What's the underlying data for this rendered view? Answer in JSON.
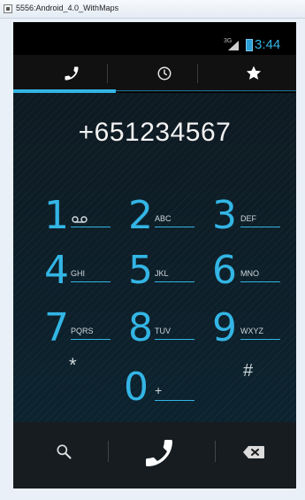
{
  "window": {
    "title": "5556:Android_4.0_WithMaps"
  },
  "status": {
    "network": "3G",
    "time": "3:44"
  },
  "tabs": [
    {
      "name": "phone",
      "icon": "phone-icon",
      "selected": true
    },
    {
      "name": "recent",
      "icon": "clock-icon",
      "selected": false
    },
    {
      "name": "favorites",
      "icon": "star-icon",
      "selected": false
    }
  ],
  "dialer": {
    "number": "+651234567"
  },
  "keys": [
    {
      "digit": "1",
      "letters": "",
      "icon": "voicemail-icon"
    },
    {
      "digit": "2",
      "letters": "ABC"
    },
    {
      "digit": "3",
      "letters": "DEF"
    },
    {
      "digit": "4",
      "letters": "GHI"
    },
    {
      "digit": "5",
      "letters": "JKL"
    },
    {
      "digit": "6",
      "letters": "MNO"
    },
    {
      "digit": "7",
      "letters": "PQRS"
    },
    {
      "digit": "8",
      "letters": "TUV"
    },
    {
      "digit": "9",
      "letters": "WXYZ"
    },
    {
      "digit": "*",
      "letters": ""
    },
    {
      "digit": "0",
      "letters": "+"
    },
    {
      "digit": "#",
      "letters": ""
    }
  ],
  "actions": {
    "search": "search-icon",
    "call": "phone-call-icon",
    "delete": "backspace-icon"
  },
  "colors": {
    "accent": "#33b5e5",
    "background": "#0f1e27"
  }
}
